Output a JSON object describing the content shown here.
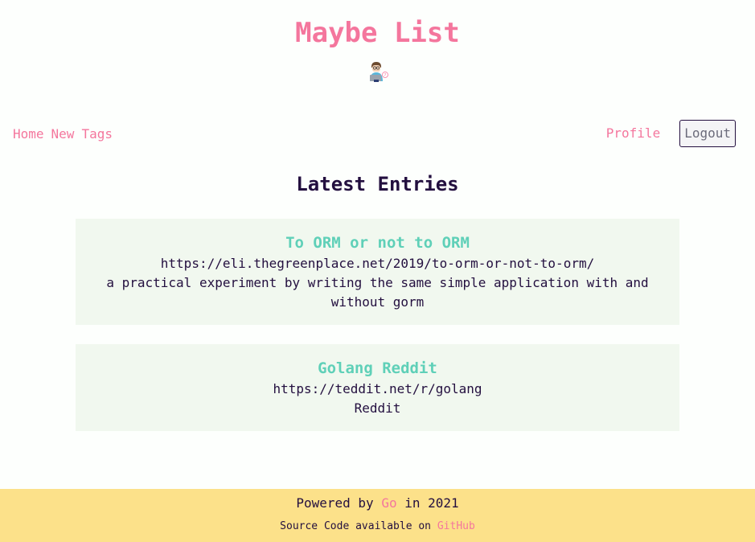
{
  "site": {
    "title": "Maybe List"
  },
  "logo": {
    "icon": "person-laptop-icon"
  },
  "nav": {
    "left": [
      {
        "label": "Home"
      },
      {
        "label": "New"
      },
      {
        "label": "Tags"
      }
    ],
    "profile_label": "Profile",
    "logout_label": "Logout"
  },
  "main": {
    "heading": "Latest Entries",
    "entries": [
      {
        "title": "To ORM or not to ORM",
        "url": "https://eli.thegreenplace.net/2019/to-orm-or-not-to-orm/",
        "description": "a practical experiment by writing the same simple application with and without gorm"
      },
      {
        "title": "Golang Reddit",
        "url": "https://teddit.net/r/golang",
        "description": "Reddit"
      }
    ]
  },
  "footer": {
    "powered_prefix": "Powered by",
    "powered_link": "Go",
    "powered_suffix": "in 2021",
    "source_prefix": "Source Code available on",
    "source_link": "GitHub"
  },
  "colors": {
    "accent_pink": "#f4769d",
    "entry_title_teal": "#5fd0b8",
    "text_dark": "#230f3f",
    "entry_bg": "#f1f8ef",
    "footer_bg": "#fce18a"
  }
}
